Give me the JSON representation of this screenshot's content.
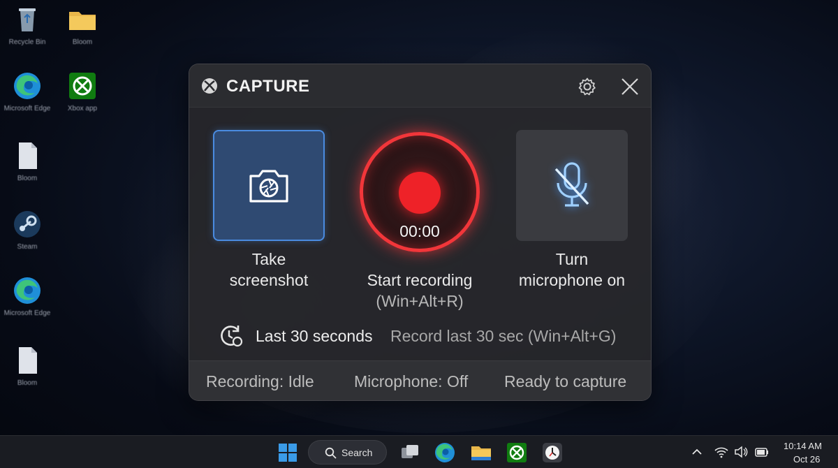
{
  "desktop": {
    "icons": [
      {
        "label": "Recycle Bin",
        "icon": "recycle-bin-icon"
      },
      {
        "label": "Bloom",
        "icon": "folder-icon"
      },
      {
        "label": "Microsoft Edge",
        "icon": "edge-icon"
      },
      {
        "label": "Xbox app",
        "icon": "xbox-icon"
      },
      {
        "label": "Bloom",
        "icon": "file-icon"
      },
      {
        "label": "Steam",
        "icon": "steam-icon"
      },
      {
        "label": "Microsoft Edge",
        "icon": "edge-icon"
      },
      {
        "label": "Bloom",
        "icon": "file-icon"
      }
    ]
  },
  "capture": {
    "title": "CAPTURE",
    "screenshot": {
      "line1": "Take",
      "line2": "screenshot"
    },
    "recording": {
      "timer": "00:00",
      "label": "Start recording",
      "shortcut": "(Win+Alt+R)"
    },
    "microphone": {
      "line1": "Turn",
      "line2": "microphone on"
    },
    "last": {
      "label": "Last 30 seconds",
      "hint": "Record last 30 sec (Win+Alt+G)"
    },
    "status": {
      "recording": "Recording: Idle",
      "microphone": "Microphone: Off",
      "ready": "Ready to capture"
    }
  },
  "taskbar": {
    "search_label": "Search",
    "time": "10:14 AM",
    "date": "Oct 26"
  },
  "colors": {
    "record_red": "#ee2228",
    "accent_blue": "#4a8be0",
    "xbox_green": "#107c10"
  }
}
